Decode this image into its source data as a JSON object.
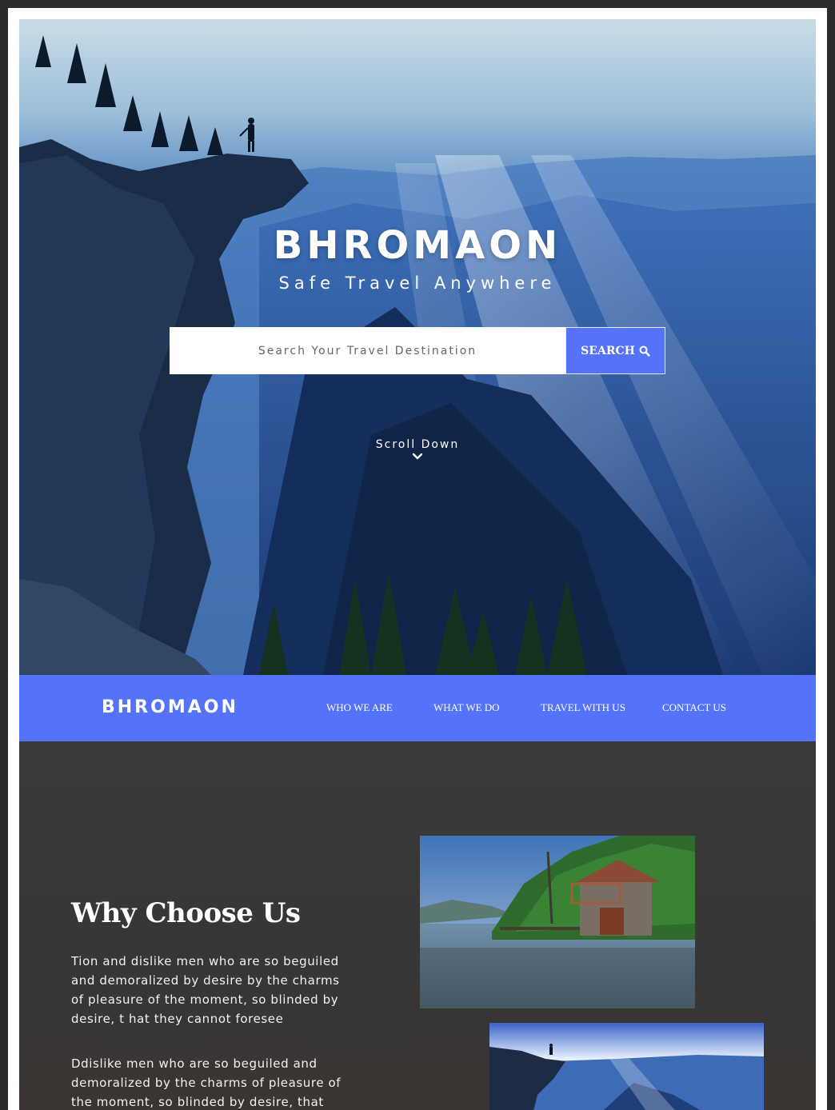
{
  "hero": {
    "title": "BHROMAON",
    "subtitle": "Safe Travel Anywhere",
    "search_placeholder": "Search Your Travel Destination",
    "search_button": "SEARCH",
    "scroll_label": "Scroll Down"
  },
  "nav": {
    "logo": "BHROMAON",
    "items": [
      "WHO WE ARE",
      "WHAT WE DO",
      "TRAVEL WITH US",
      "CONTACT US"
    ]
  },
  "about": {
    "heading": "Why Choose Us",
    "paragraphs": [
      "Tion and dislike men who are so beguiled and demoralized by desire by the charms of pleasure of the moment, so blinded by desire, t hat they cannot foresee",
      "Ddislike men who are so beguiled and demoralized by the charms of pleasure of the moment, so blinded by desire, that"
    ]
  },
  "colors": {
    "accent": "#5572fb",
    "section_bg": "#383838",
    "frame": "#ffffff"
  }
}
